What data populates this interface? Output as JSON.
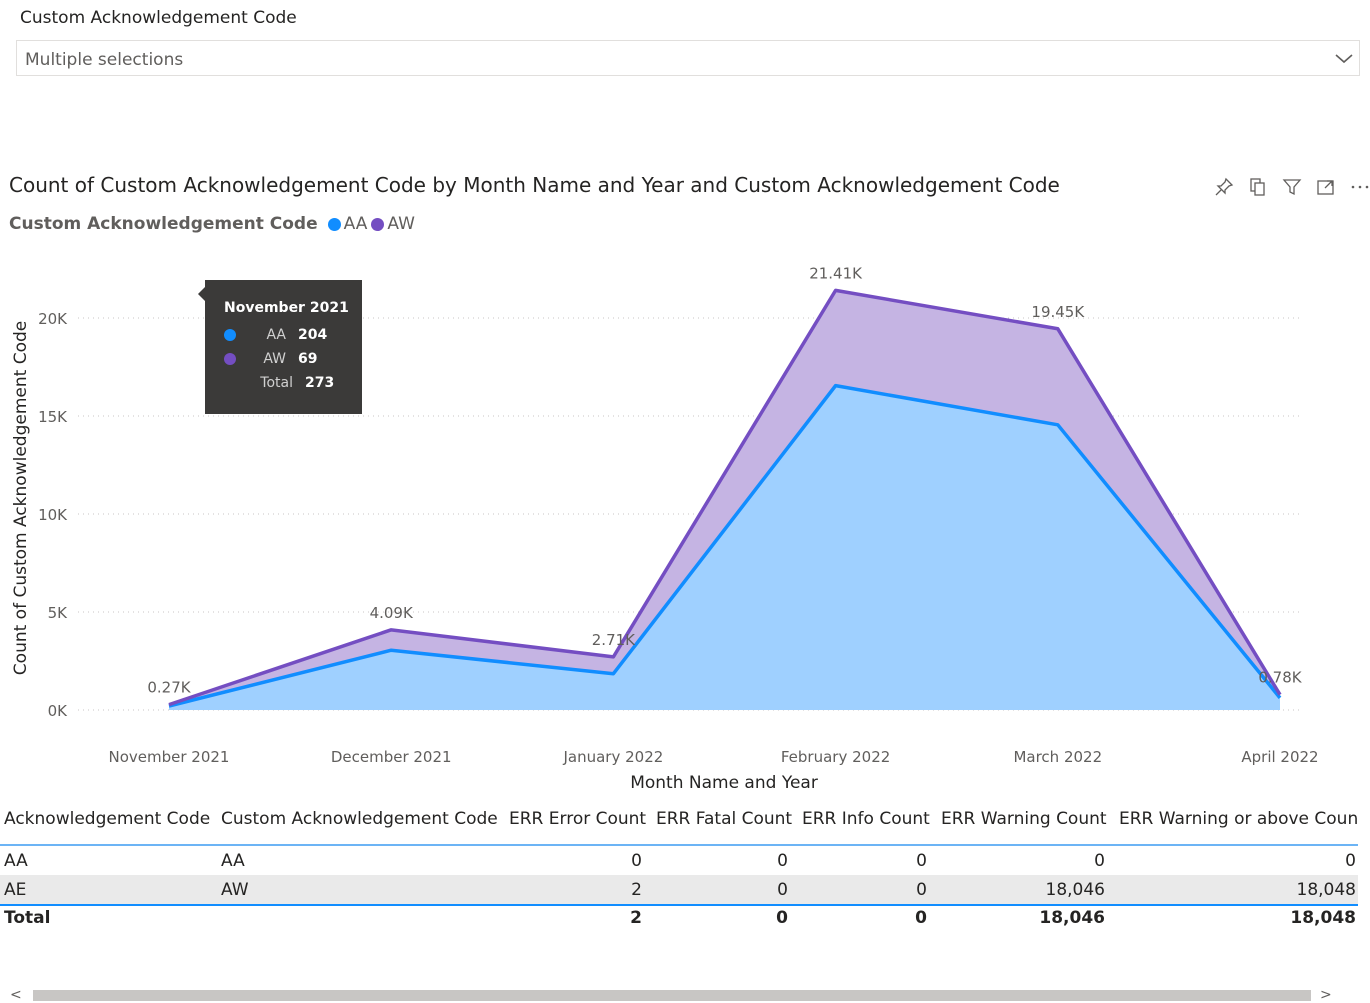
{
  "slicer": {
    "title": "Custom Acknowledgement Code",
    "value": "Multiple selections"
  },
  "header_icons": [
    "pin-icon",
    "copy-icon",
    "filter-icon",
    "focus-mode-icon",
    "more-options-icon"
  ],
  "chart_data": {
    "type": "area",
    "title": "Count of Custom Acknowledgement Code by Month Name and Year and Custom Acknowledgement Code",
    "xlabel": "Month Name and Year",
    "ylabel": "Count of Custom Acknowledgement Code",
    "legend_title": "Custom Acknowledgement Code",
    "legend_position": "top-left",
    "stacked": true,
    "categories": [
      "November 2021",
      "December 2021",
      "January 2022",
      "February 2022",
      "March 2022",
      "April 2022"
    ],
    "series": [
      {
        "name": "AA",
        "color": "#118dff",
        "fill": "#9fd0ff",
        "values": [
          204,
          3050,
          1850,
          16550,
          14550,
          620
        ]
      },
      {
        "name": "AW",
        "color": "#744ec2",
        "fill": "#c5b4e3",
        "values": [
          69,
          1040,
          860,
          4860,
          4900,
          160
        ]
      }
    ],
    "totals_labels": [
      "0.27K",
      "4.09K",
      "2.71K",
      "21.41K",
      "19.45K",
      "0.78K"
    ],
    "ylim": [
      0,
      22000
    ],
    "yticks": [
      0,
      5000,
      10000,
      15000,
      20000
    ],
    "ytick_labels": [
      "0K",
      "5K",
      "10K",
      "15K",
      "20K"
    ],
    "grid": true
  },
  "tooltip": {
    "title": "November 2021",
    "rows": [
      {
        "label": "AA",
        "value": "204",
        "color": "#118dff"
      },
      {
        "label": "AW",
        "value": "69",
        "color": "#744ec2"
      }
    ],
    "total_label": "Total",
    "total_value": "273"
  },
  "table": {
    "columns": [
      "Acknowledgement Code",
      "Custom Acknowledgement Code",
      "ERR Error Count",
      "ERR Fatal Count",
      "ERR Info Count",
      "ERR Warning Count",
      "ERR Warning or above Count"
    ],
    "rows": [
      [
        "AA",
        "AA",
        "0",
        "0",
        "0",
        "0",
        "0"
      ],
      [
        "AE",
        "AW",
        "2",
        "0",
        "0",
        "18,046",
        "18,048"
      ]
    ],
    "total": [
      "Total",
      "",
      "2",
      "0",
      "0",
      "18,046",
      "18,048"
    ]
  },
  "scroll": {
    "left": "<",
    "right": ">"
  }
}
